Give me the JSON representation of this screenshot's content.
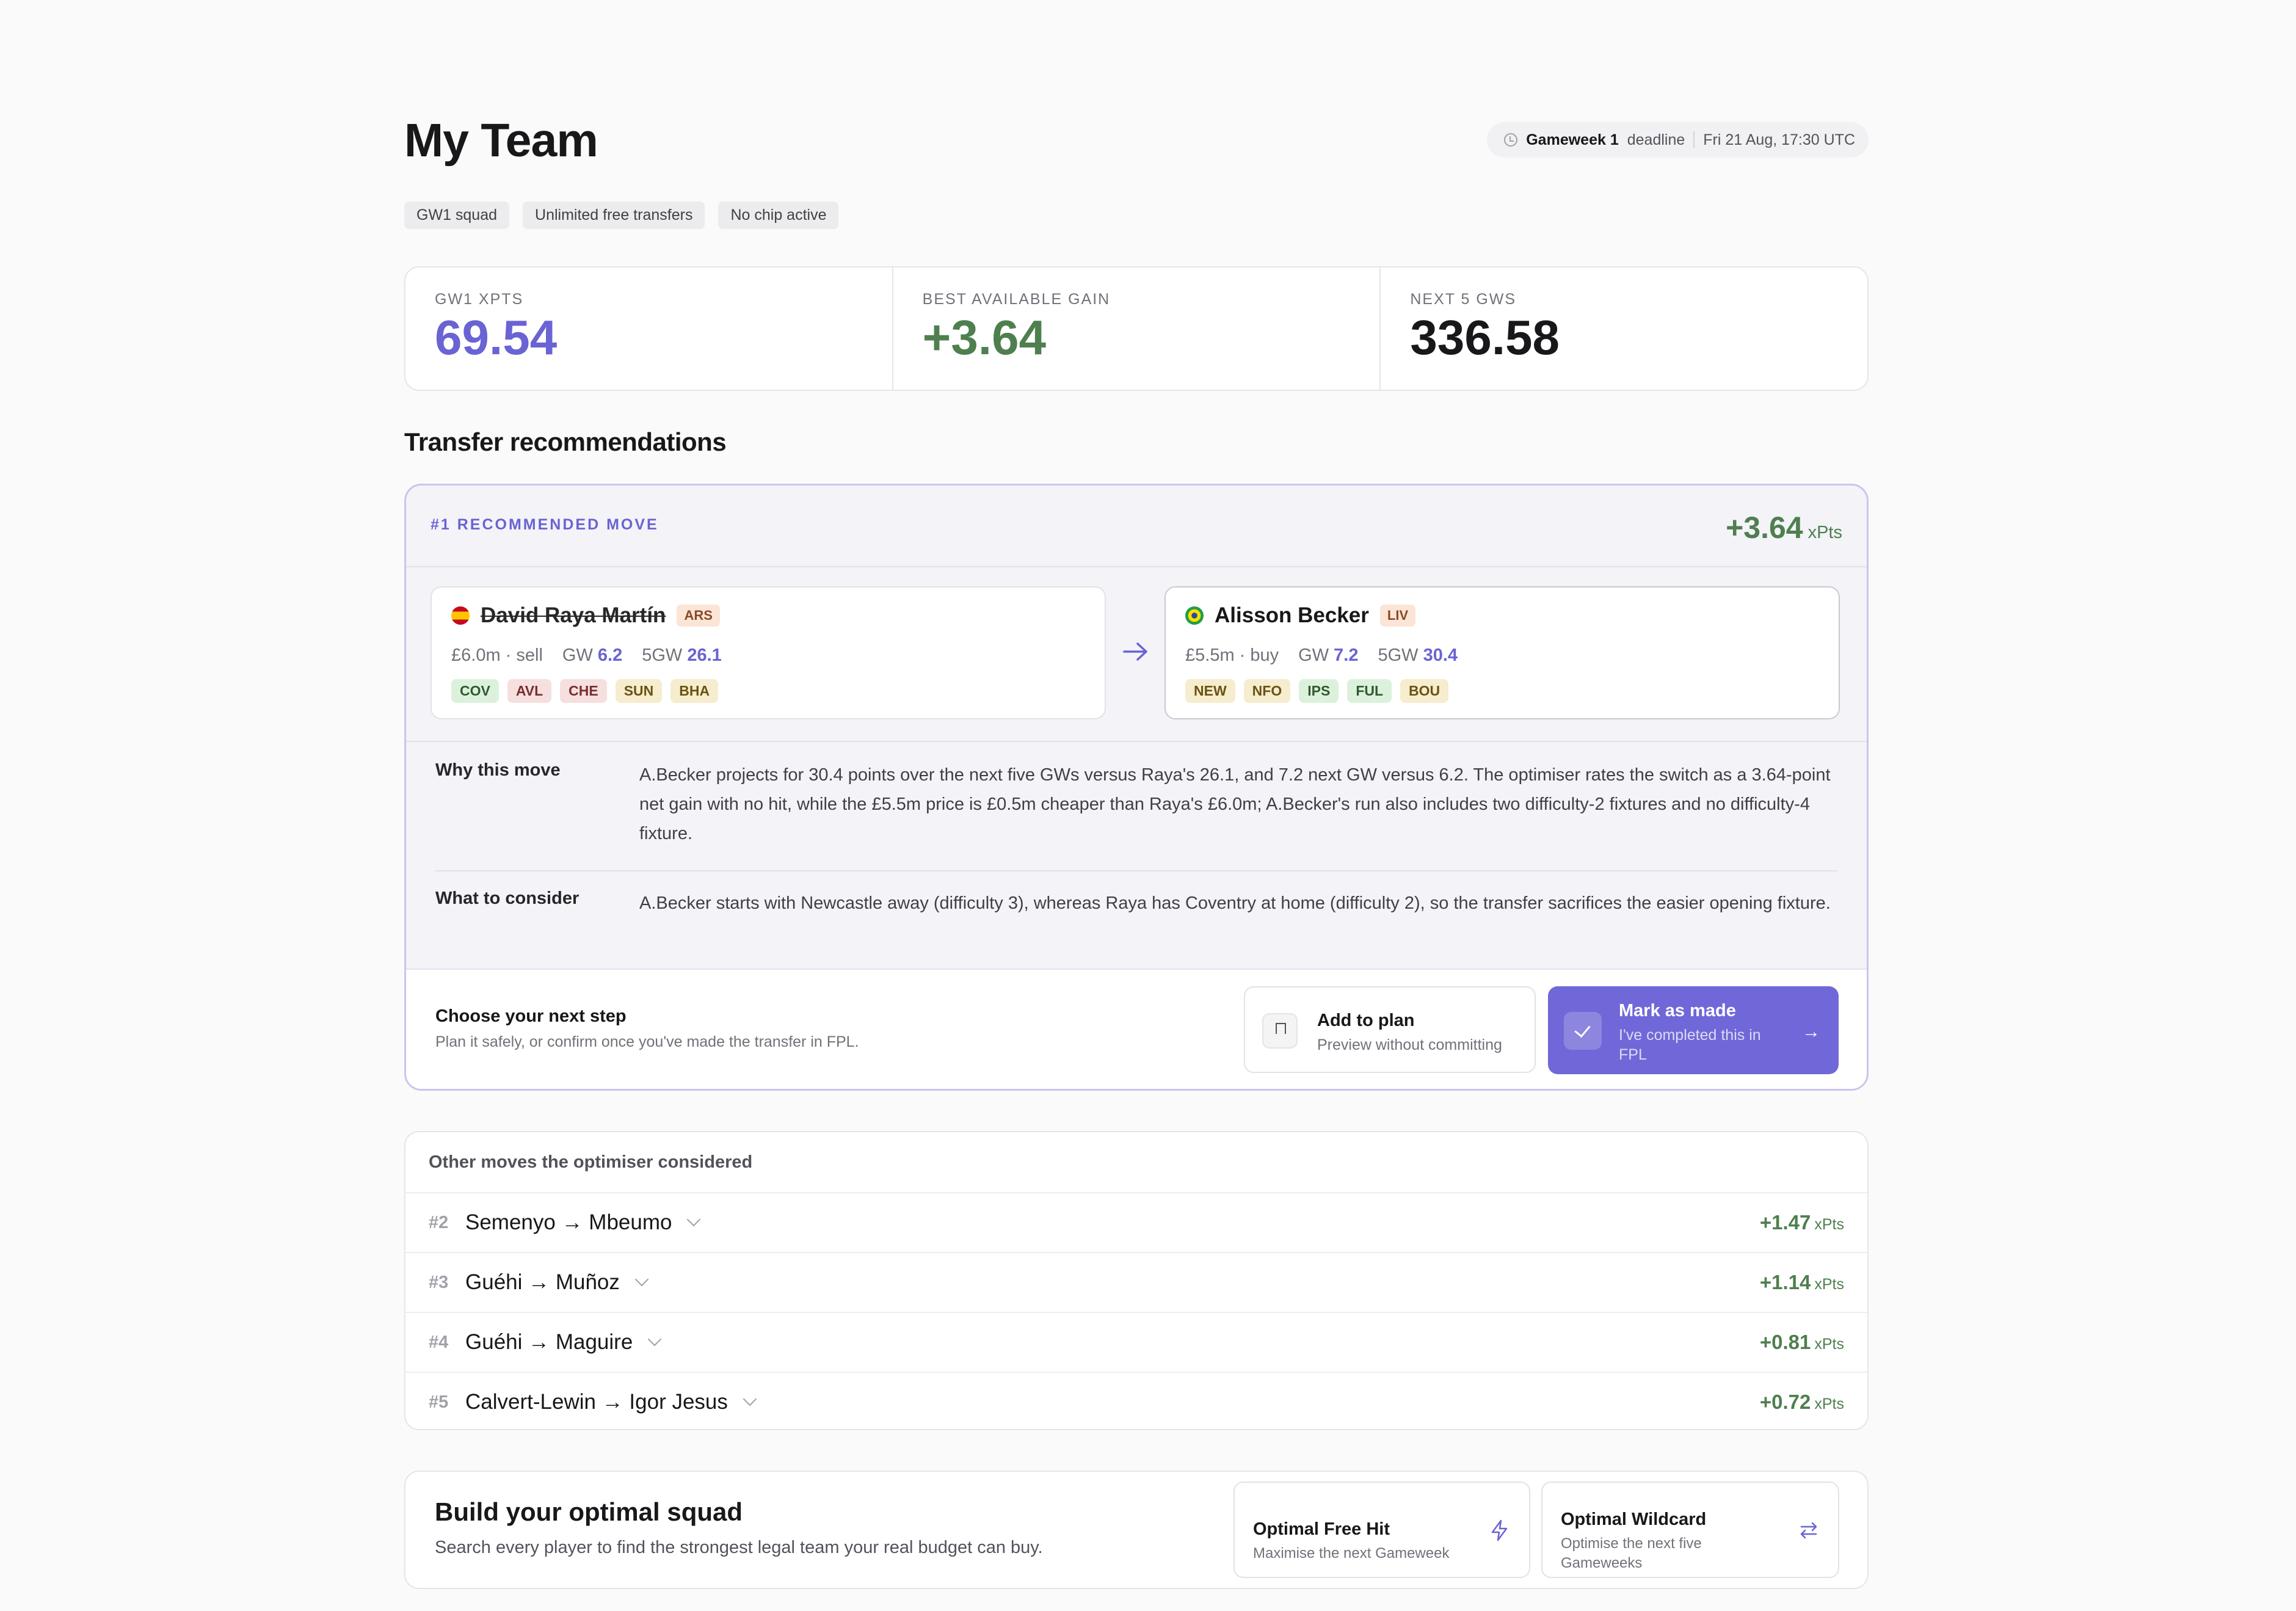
{
  "header": {
    "title": "My Team",
    "gameweek": "Gameweek 1",
    "deadline_label": "deadline",
    "deadline_time": "Fri 21 Aug, 17:30 UTC"
  },
  "chips": [
    "GW1 squad",
    "Unlimited free transfers",
    "No chip active"
  ],
  "stats": [
    {
      "label": "GW1 XPTS",
      "value": "69.54"
    },
    {
      "label": "BEST AVAILABLE GAIN",
      "value": "+3.64"
    },
    {
      "label": "NEXT 5 GWS",
      "value": "336.58"
    }
  ],
  "transfers": {
    "title": "Transfer recommendations",
    "top": {
      "tag": "#1 RECOMMENDED MOVE",
      "gain": "+3.64",
      "gain_unit": "xPts",
      "out": {
        "name": "David Raya Martín",
        "team": "ARS",
        "price": "£6.0m · sell",
        "gw_label": "GW",
        "gw": "6.2",
        "gw5_label": "5GW",
        "gw5": "26.1",
        "fixtures": [
          "COV",
          "AVL",
          "CHE",
          "SUN",
          "BHA"
        ]
      },
      "in": {
        "name": "Alisson Becker",
        "team": "LIV",
        "price": "£5.5m · buy",
        "gw_label": "GW",
        "gw": "7.2",
        "gw5_label": "5GW",
        "gw5": "30.4",
        "fixtures": [
          "NEW",
          "NFO",
          "IPS",
          "FUL",
          "BOU"
        ]
      },
      "why_label": "Why this move",
      "why_text": "A.Becker projects for 30.4 points over the next five GWs versus Raya's 26.1, and 7.2 next GW versus 6.2. The optimiser rates the switch as a 3.64-point net gain with no hit, while the £5.5m price is £0.5m cheaper than Raya's £6.0m; A.Becker's run also includes two difficulty-2 fixtures and no difficulty-4 fixture.",
      "consider_label": "What to consider",
      "consider_text": "A.Becker starts with Newcastle away (difficulty 3), whereas Raya has Coventry at home (difficulty 2), so the transfer sacrifices the easier opening fixture.",
      "next_title": "Choose your next step",
      "next_sub": "Plan it safely, or confirm once you've made the transfer in FPL.",
      "plan_title": "Add to plan",
      "plan_sub": "Preview without committing",
      "made_title": "Mark as made",
      "made_sub": "I've completed this in FPL"
    },
    "others_title": "Other moves the optimiser considered",
    "others": [
      {
        "rank": "#2",
        "move": "Semenyo → Mbeumo",
        "gain": "+1.47",
        "unit": "xPts"
      },
      {
        "rank": "#3",
        "move": "Guéhi → Muñoz",
        "gain": "+1.14",
        "unit": "xPts"
      },
      {
        "rank": "#4",
        "move": "Guéhi → Maguire",
        "gain": "+0.81",
        "unit": "xPts"
      },
      {
        "rank": "#5",
        "move": "Calvert-Lewin → Igor Jesus",
        "gain": "+0.72",
        "unit": "xPts"
      }
    ]
  },
  "build": {
    "title": "Build your optimal squad",
    "subtitle": "Search every player to find the strongest legal team your real budget can buy.",
    "free_hit_title": "Optimal Free Hit",
    "free_hit_sub": "Maximise the next Gameweek",
    "wildcard_title": "Optimal Wildcard",
    "wildcard_sub": "Optimise the next five Gameweeks"
  },
  "colors": {
    "accent": "#6a63d3",
    "gain": "#4f7f4f",
    "button": "#7068d8"
  }
}
